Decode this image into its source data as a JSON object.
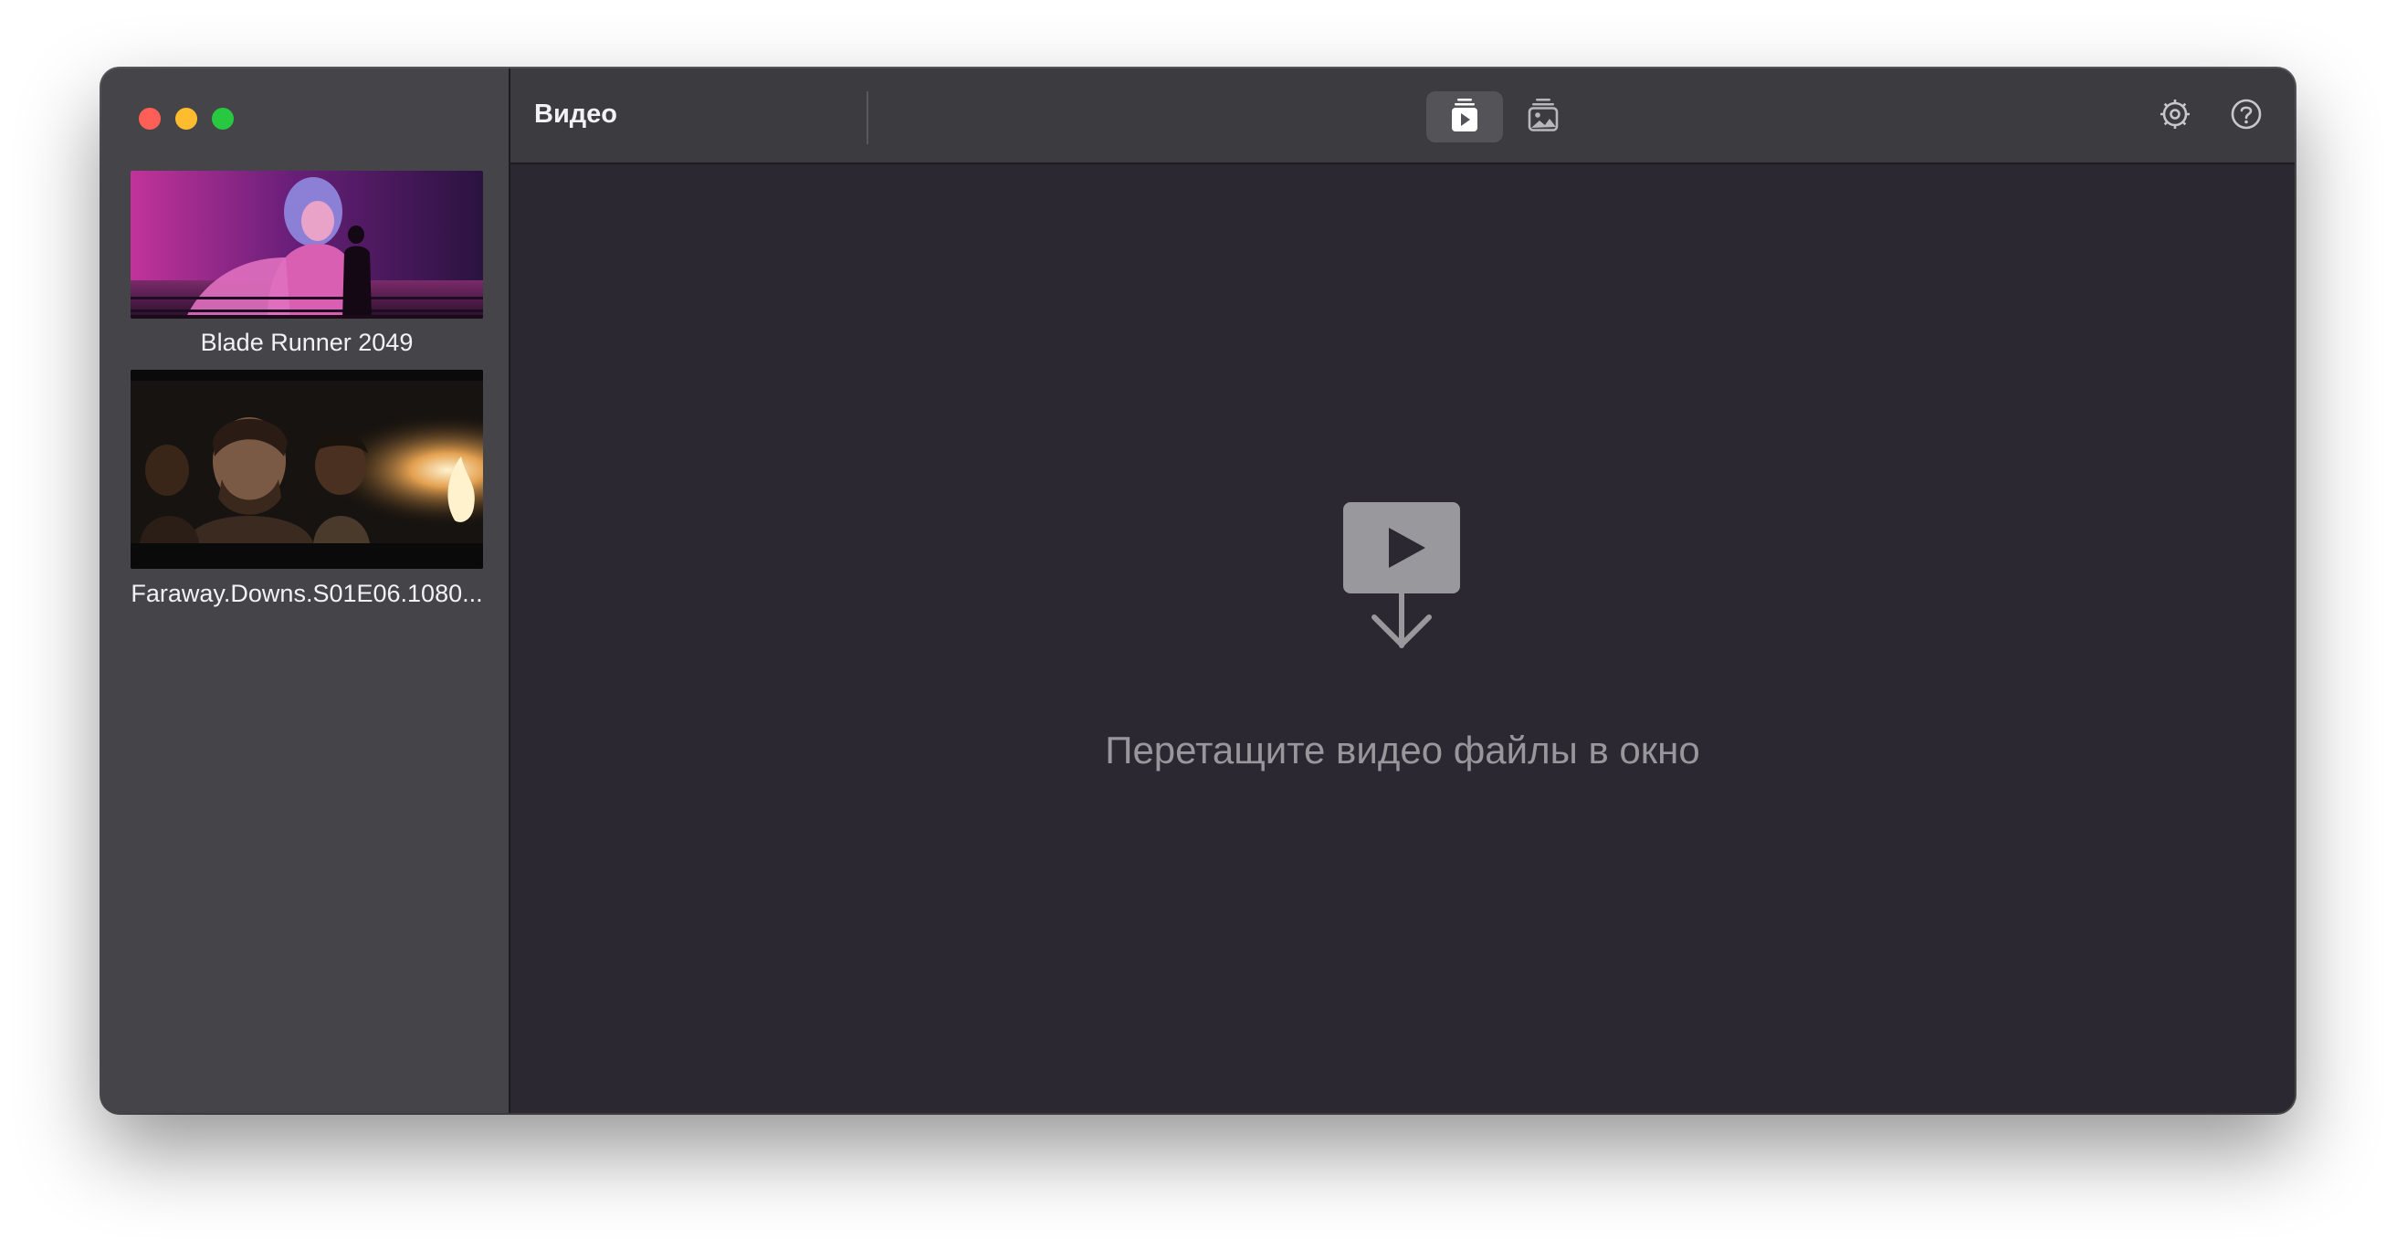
{
  "window": {
    "traffic_lights": {
      "close_color": "#ff5f57",
      "minimize_color": "#febc2e",
      "zoom_color": "#28c840"
    }
  },
  "toolbar": {
    "title": "Видео",
    "view_buttons": [
      {
        "icon": "video-file-icon",
        "selected": true
      },
      {
        "icon": "image-stack-icon",
        "selected": false
      }
    ],
    "settings_icon": "gear-icon",
    "help_icon": "question-mark-icon"
  },
  "sidebar": {
    "items": [
      {
        "title": "Blade Runner 2049",
        "thumbnail": "magenta-neon-scene"
      },
      {
        "title": "Faraway.Downs.S01E06.1080...",
        "thumbnail": "dark-campfire-scene"
      }
    ]
  },
  "main": {
    "drop_icon": "video-download-icon",
    "drop_hint": "Перетащите видео файлы в окно"
  },
  "colors": {
    "sidebar_bg": "#454448",
    "toolbar_bg": "#3c3b40",
    "content_bg": "#2b2831",
    "text_primary": "#f2f2f4",
    "text_secondary": "#98979c"
  }
}
